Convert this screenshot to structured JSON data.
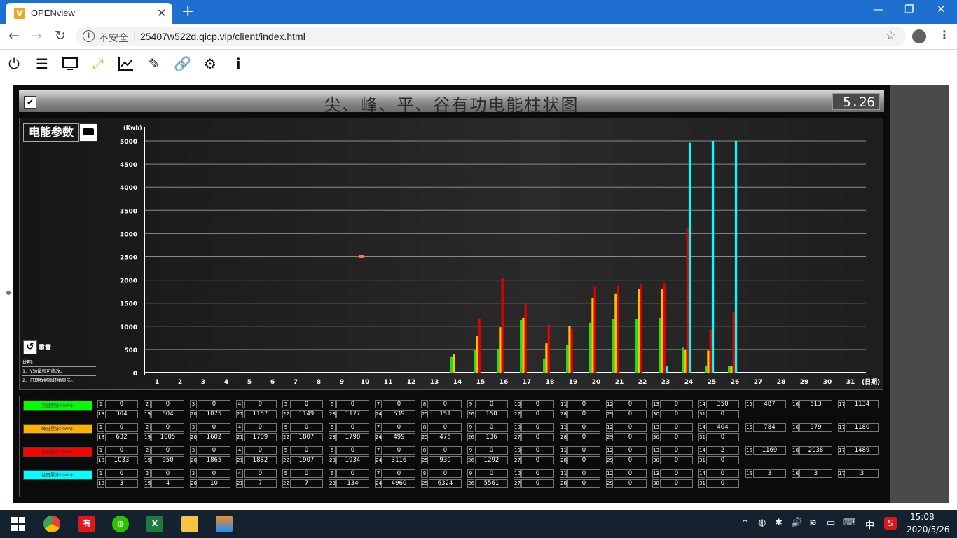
{
  "browser": {
    "tab_title": "OPENview",
    "favicon": "V",
    "insecure_label": "不安全",
    "url": "25407w522d.qicp.vip/client/index.html"
  },
  "toolbar_icons": [
    "power-icon",
    "menu-icon",
    "monitor-icon",
    "expand-icon",
    "trend-chart-icon",
    "edit-icon",
    "link-icon",
    "settings-icon",
    "info-icon"
  ],
  "panel": {
    "title": "尖、峰、平、谷有功电能柱状图",
    "date": "5.26",
    "param_label": "电能参数",
    "refresh_label": "重置",
    "notes": [
      "说明:",
      "1、Y轴量程可修改。",
      "2、日期数据循环播显示。"
    ]
  },
  "chart_data": {
    "type": "bar",
    "ylabel": "(Kwh)",
    "xlabel": "(日期)",
    "ylim": [
      0,
      5000
    ],
    "yticks": [
      0,
      500,
      1000,
      1500,
      2000,
      2500,
      3000,
      3500,
      4000,
      4500,
      5000
    ],
    "categories": [
      "1",
      "2",
      "3",
      "4",
      "5",
      "6",
      "7",
      "8",
      "9",
      "10",
      "11",
      "12",
      "13",
      "14",
      "15",
      "16",
      "17",
      "18",
      "19",
      "20",
      "21",
      "22",
      "23",
      "24",
      "25",
      "26",
      "27",
      "28",
      "29",
      "30",
      "31"
    ],
    "colors": {
      "green": "#22dd22",
      "yellow": "#ffc000",
      "red": "#e00000",
      "cyan": "#00ffff"
    },
    "series": [
      {
        "name": "尖日累计(Kwh):",
        "color": "#22dd22",
        "values": [
          0,
          0,
          0,
          0,
          0,
          0,
          0,
          0,
          0,
          0,
          0,
          0,
          0,
          350,
          487,
          513,
          1134,
          304,
          604,
          1075,
          1157,
          1149,
          1177,
          539,
          151,
          150,
          0,
          0,
          0,
          0,
          0
        ]
      },
      {
        "name": "峰日累计(Kwh):",
        "color": "#ffc000",
        "values": [
          0,
          0,
          0,
          0,
          0,
          0,
          0,
          0,
          0,
          0,
          0,
          0,
          0,
          404,
          784,
          979,
          1180,
          632,
          1005,
          1602,
          1709,
          1807,
          1798,
          499,
          476,
          136,
          0,
          0,
          0,
          0,
          0
        ]
      },
      {
        "name": "平日累计(Kwh):",
        "color": "#e00000",
        "values": [
          0,
          0,
          0,
          0,
          0,
          0,
          0,
          0,
          0,
          0,
          0,
          0,
          0,
          2,
          1169,
          2038,
          1489,
          1033,
          950,
          1865,
          1882,
          1907,
          1934,
          3116,
          930,
          1292,
          0,
          0,
          0,
          0,
          0
        ]
      },
      {
        "name": "谷日累计(Kwh):",
        "color": "#00ffff",
        "values": [
          0,
          0,
          0,
          0,
          0,
          0,
          0,
          0,
          0,
          0,
          0,
          0,
          0,
          0,
          3,
          3,
          3,
          3,
          4,
          10,
          7,
          7,
          134,
          4960,
          6324,
          5561,
          0,
          0,
          0,
          0,
          0
        ]
      }
    ],
    "annotation": "2500"
  },
  "tables": [
    {
      "label": "尖日累计(Kwh):",
      "color": "#00ff00",
      "values": [
        0,
        0,
        0,
        0,
        0,
        0,
        0,
        0,
        0,
        0,
        0,
        0,
        0,
        350,
        487,
        513,
        1134,
        304,
        604,
        1075,
        1157,
        1149,
        1177,
        539,
        151,
        150,
        0,
        0,
        0,
        0,
        0
      ]
    },
    {
      "label": "峰日累计(Kwh):",
      "color": "#ffb000",
      "values": [
        0,
        0,
        0,
        0,
        0,
        0,
        0,
        0,
        0,
        0,
        0,
        0,
        0,
        404,
        784,
        979,
        1180,
        632,
        1005,
        1602,
        1709,
        1807,
        1798,
        499,
        476,
        136,
        0,
        0,
        0,
        0,
        0
      ]
    },
    {
      "label": "平日累计(Kwh):",
      "color": "#ff0000",
      "values": [
        0,
        0,
        0,
        0,
        0,
        0,
        0,
        0,
        0,
        0,
        0,
        0,
        0,
        2,
        1169,
        2038,
        1489,
        1033,
        950,
        1865,
        1882,
        1907,
        1934,
        3116,
        930,
        1292,
        0,
        0,
        0,
        0,
        0
      ]
    },
    {
      "label": "谷日累计(Kwh):",
      "color": "#00ffff",
      "values": [
        0,
        0,
        0,
        0,
        0,
        0,
        0,
        0,
        0,
        0,
        0,
        0,
        0,
        0,
        3,
        3,
        3,
        3,
        4,
        10,
        7,
        7,
        134,
        4960,
        6324,
        5561,
        0,
        0,
        0,
        0,
        0
      ]
    }
  ],
  "taskbar": {
    "time": "15:08",
    "date": "2020/5/26",
    "ime": "中",
    "apps": [
      "windows-start-icon",
      "chrome-icon",
      "youdao-icon",
      "wechat-icon",
      "excel-icon",
      "file-explorer-icon",
      "app-icon"
    ]
  }
}
